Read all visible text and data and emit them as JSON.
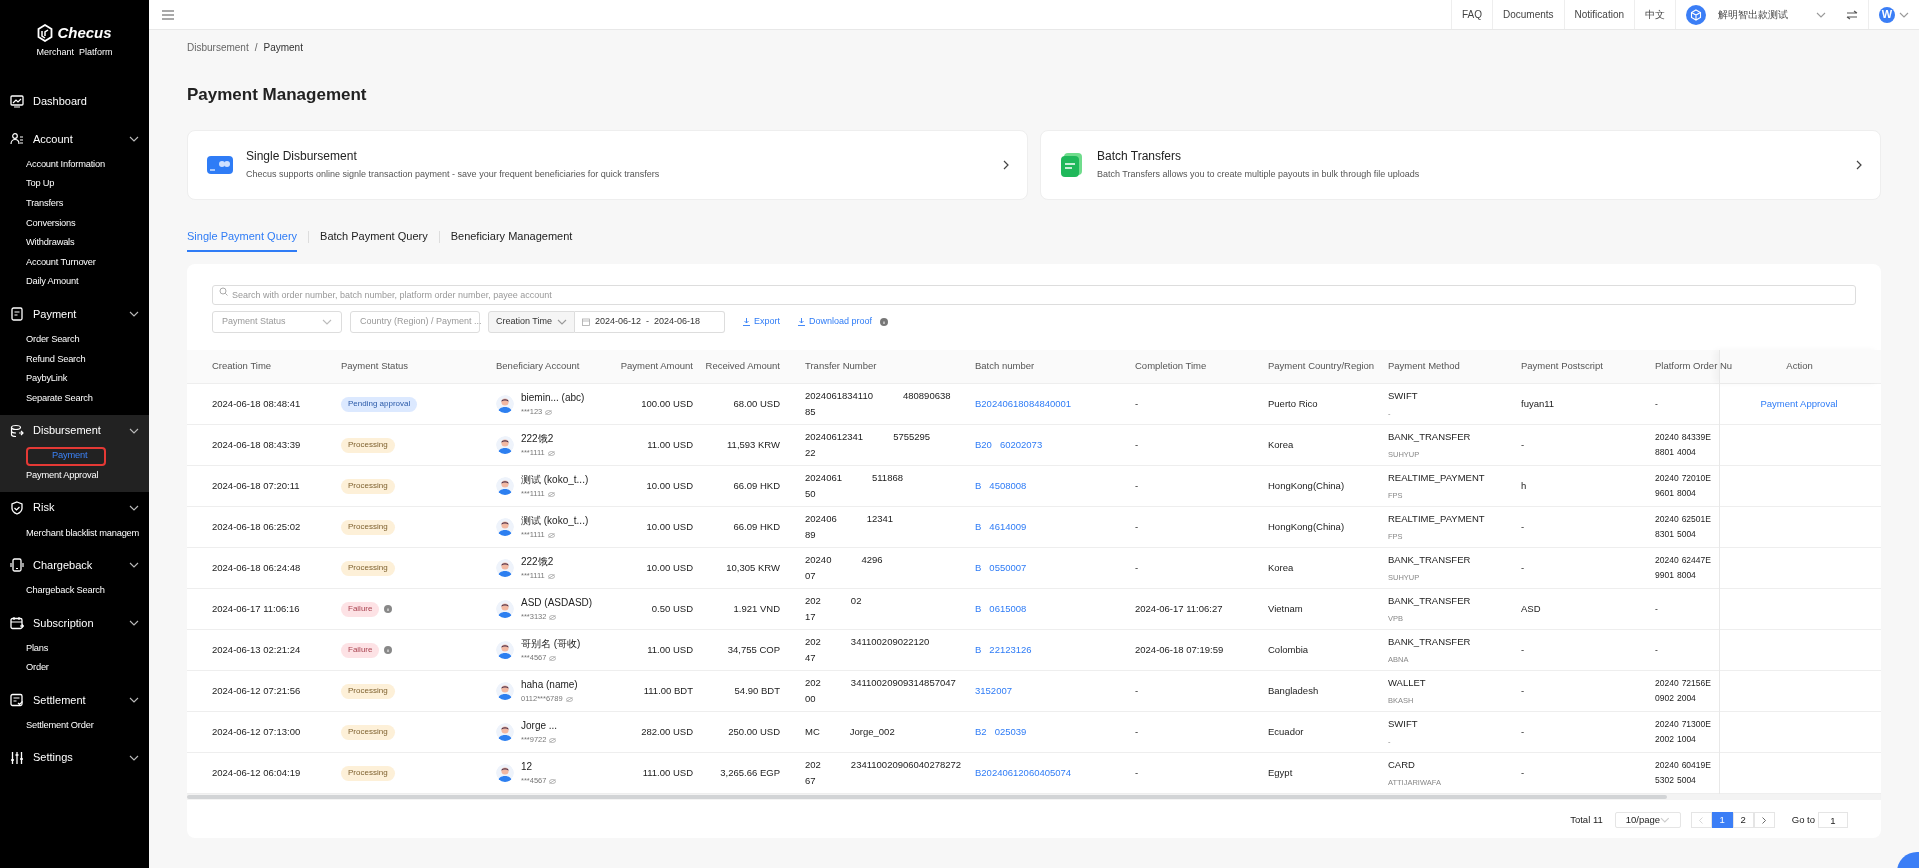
{
  "brand": {
    "name": "Checus",
    "subtitle": "Merchant  Platform"
  },
  "sidebar": [
    {
      "label": "Dashboard",
      "kind": "link",
      "active": false
    },
    {
      "label": "Account",
      "kind": "group",
      "active": false,
      "expanded": true,
      "children": [
        {
          "label": "Account Information",
          "selected": false
        },
        {
          "label": "Top Up",
          "selected": false
        },
        {
          "label": "Transfers",
          "selected": false
        },
        {
          "label": "Conversions",
          "selected": false
        },
        {
          "label": "Withdrawals",
          "selected": false
        },
        {
          "label": "Account Turnover",
          "selected": false
        },
        {
          "label": "Daily Amount",
          "selected": false
        }
      ]
    },
    {
      "label": "Payment",
      "kind": "group",
      "active": false,
      "expanded": true,
      "children": [
        {
          "label": "Order Search",
          "selected": false
        },
        {
          "label": "Refund Search",
          "selected": false
        },
        {
          "label": "PaybyLink",
          "selected": false
        },
        {
          "label": "Separate Search",
          "selected": false
        }
      ]
    },
    {
      "label": "Disbursement",
      "kind": "group",
      "active": true,
      "expanded": true,
      "children": [
        {
          "label": "Payment",
          "selected": true
        },
        {
          "label": "Payment Approval",
          "selected": false
        }
      ]
    },
    {
      "label": "Risk",
      "kind": "group",
      "active": false,
      "expanded": true,
      "children": [
        {
          "label": "Merchant blacklist managem",
          "selected": false
        }
      ]
    },
    {
      "label": "Chargeback",
      "kind": "group",
      "active": false,
      "expanded": true,
      "children": [
        {
          "label": "Chargeback Search",
          "selected": false
        }
      ]
    },
    {
      "label": "Subscription",
      "kind": "group",
      "active": false,
      "expanded": true,
      "children": [
        {
          "label": "Plans",
          "selected": false
        },
        {
          "label": "Order",
          "selected": false
        }
      ]
    },
    {
      "label": "Settlement",
      "kind": "group",
      "active": false,
      "expanded": true,
      "children": [
        {
          "label": "Settlement Order",
          "selected": false
        }
      ]
    },
    {
      "label": "Settings",
      "kind": "group",
      "active": false,
      "expanded": true
    }
  ],
  "header": {
    "links": [
      "FAQ",
      "Documents",
      "Notification",
      "中文"
    ],
    "merchant": "解明智出款测试",
    "user_initial": "W"
  },
  "breadcrumb": [
    "Disbursement",
    "/",
    "Payment"
  ],
  "title": "Payment Management",
  "cards": [
    {
      "kind": "single",
      "title": "Single Disbursement",
      "description": "Checus supports online signle transaction payment - save your frequent beneficiaries for quick transfers"
    },
    {
      "kind": "batch",
      "title": "Batch Transfers",
      "description": "Batch Transfers allows you to create multiple payouts in bulk through file uploads"
    }
  ],
  "tabs": [
    {
      "label": "Single Payment Query",
      "selected": true
    },
    {
      "label": "Batch Payment Query",
      "selected": false
    },
    {
      "label": "Beneficiary Management",
      "selected": false
    }
  ],
  "search": {
    "placeholder": "Search with order number, batch number, platform order number, payee account"
  },
  "filters": {
    "status_placeholder": "Payment Status",
    "country_placeholder": "Country (Region) / Payment ...",
    "time_field": "Creation Time",
    "date_from": "2024-06-12",
    "date_sep": "-",
    "date_to": "2024-06-18",
    "export": "Export",
    "download": "Download proof"
  },
  "table": {
    "columns": [
      "Creation Time",
      "Payment Status",
      "Beneficiary Account",
      "Payment Amount",
      "Received Amount",
      "Transfer Number",
      "Batch number",
      "Completion Time",
      "Payment Country/Region",
      "Payment Method",
      "Payment Postscript",
      "Platform Order Nu",
      "Action"
    ],
    "rows": [
      {
        "time": "2024-06-18 08:48:41",
        "status": {
          "label": "Pending approval",
          "kind": "pending"
        },
        "name": "biemin... (abc)",
        "account": "***123",
        "amount": "100.00 USD",
        "received": "68.00 USD",
        "transfer": [
          [
            "2024061834110",
            "480890638"
          ],
          [
            "85"
          ]
        ],
        "batch": [
          "B20240618084840001"
        ],
        "completion": "-",
        "country": "Puerto Rico",
        "method": "SWIFT",
        "channel": "-",
        "postscript": "fuyan11",
        "platform": [
          [
            "-"
          ]
        ],
        "action": "Payment Approval"
      },
      {
        "time": "2024-06-18 08:43:39",
        "status": {
          "label": "Processing",
          "kind": "processing"
        },
        "name": "222饿2",
        "account": "***1111",
        "amount": "11.00 USD",
        "received": "11,593 KRW",
        "transfer": [
          [
            "20240612341",
            "5755295"
          ],
          [
            "22"
          ]
        ],
        "batch": [
          "B20",
          "60202073"
        ],
        "completion": "-",
        "country": "Korea",
        "method": "BANK_TRANSFER",
        "channel": "SUHYUP",
        "postscript": "-",
        "platform": [
          [
            "20240",
            "84339E"
          ],
          [
            "8801",
            "4004"
          ]
        ]
      },
      {
        "time": "2024-06-18 07:20:11",
        "status": {
          "label": "Processing",
          "kind": "processing"
        },
        "name": "测试 (koko_t...)",
        "account": "***1111",
        "amount": "10.00 USD",
        "received": "66.09 HKD",
        "transfer": [
          [
            "2024061",
            "511868"
          ],
          [
            "50"
          ]
        ],
        "batch": [
          "B",
          "4508008"
        ],
        "completion": "-",
        "country": "HongKong(China)",
        "method": "REALTIME_PAYMENT",
        "channel": "FPS",
        "postscript": "h",
        "platform": [
          [
            "20240",
            "72010E"
          ],
          [
            "9601",
            "8004"
          ]
        ]
      },
      {
        "time": "2024-06-18 06:25:02",
        "status": {
          "label": "Processing",
          "kind": "processing"
        },
        "name": "测试 (koko_t...)",
        "account": "***1111",
        "amount": "10.00 USD",
        "received": "66.09 HKD",
        "transfer": [
          [
            "202406",
            "12341"
          ],
          [
            "89"
          ]
        ],
        "batch": [
          "B",
          "4614009"
        ],
        "completion": "-",
        "country": "HongKong(China)",
        "method": "REALTIME_PAYMENT",
        "channel": "FPS",
        "postscript": "-",
        "platform": [
          [
            "20240",
            "62501E"
          ],
          [
            "8301",
            "5004"
          ]
        ]
      },
      {
        "time": "2024-06-18 06:24:48",
        "status": {
          "label": "Processing",
          "kind": "processing"
        },
        "name": "222饿2",
        "account": "***1111",
        "amount": "10.00 USD",
        "received": "10,305 KRW",
        "transfer": [
          [
            "20240",
            "4296"
          ],
          [
            "07"
          ]
        ],
        "batch": [
          "B",
          "0550007"
        ],
        "completion": "-",
        "country": "Korea",
        "method": "BANK_TRANSFER",
        "channel": "SUHYUP",
        "postscript": "-",
        "platform": [
          [
            "20240",
            "62447E"
          ],
          [
            "9901",
            "8004"
          ]
        ]
      },
      {
        "time": "2024-06-17 11:06:16",
        "status": {
          "label": "Failure",
          "kind": "failure"
        },
        "name": "ASD (ASDASD)",
        "account": "***3132",
        "amount": "0.50 USD",
        "received": "1.921 VND",
        "transfer": [
          [
            "202",
            "02"
          ],
          [
            "17"
          ]
        ],
        "batch": [
          "B",
          "0615008"
        ],
        "completion": "2024-06-17 11:06:27",
        "country": "Vietnam",
        "method": "BANK_TRANSFER",
        "channel": "VPB",
        "postscript": "ASD",
        "platform": [
          [
            "-"
          ]
        ]
      },
      {
        "time": "2024-06-13 02:21:24",
        "status": {
          "label": "Failure",
          "kind": "failure"
        },
        "name": "哥别名 (哥收)",
        "account": "***4567",
        "amount": "11.00 USD",
        "received": "34,755 COP",
        "transfer": [
          [
            "202",
            "341100209022120"
          ],
          [
            "47"
          ]
        ],
        "batch": [
          "B",
          "22123126"
        ],
        "completion": "2024-06-18 07:19:59",
        "country": "Colombia",
        "method": "BANK_TRANSFER",
        "channel": "ABNA",
        "postscript": "-",
        "platform": [
          [
            "-"
          ]
        ]
      },
      {
        "time": "2024-06-12 07:21:56",
        "status": {
          "label": "Processing",
          "kind": "processing"
        },
        "name": "haha (name)",
        "account": "0112***6789",
        "amount": "111.00 BDT",
        "received": "54.90 BDT",
        "transfer": [
          [
            "202",
            "34110020909314857047"
          ],
          [
            "00"
          ]
        ],
        "batch": [
          "3152007"
        ],
        "completion": "-",
        "country": "Bangladesh",
        "method": "WALLET",
        "channel": "BKASH",
        "postscript": "-",
        "platform": [
          [
            "20240",
            "72156E"
          ],
          [
            "0902",
            "2004"
          ]
        ]
      },
      {
        "time": "2024-06-12 07:13:00",
        "status": {
          "label": "Processing",
          "kind": "processing"
        },
        "name": "Jorge ...",
        "account": "***9722",
        "amount": "282.00 USD",
        "received": "250.00 USD",
        "transfer": [
          [
            "MC",
            "Jorge_002"
          ]
        ],
        "batch": [
          "B2",
          "025039"
        ],
        "completion": "-",
        "country": "Ecuador",
        "method": "SWIFT",
        "channel": "-",
        "postscript": "-",
        "platform": [
          [
            "20240",
            "71300E"
          ],
          [
            "2002",
            "1004"
          ]
        ]
      },
      {
        "time": "2024-06-12 06:04:19",
        "status": {
          "label": "Processing",
          "kind": "processing"
        },
        "name": "12",
        "account": "***4567",
        "amount": "111.00 USD",
        "received": "3,265.66 EGP",
        "transfer": [
          [
            "202",
            "234110020906040278272"
          ],
          [
            "67"
          ]
        ],
        "batch": [
          "B20240612060405074"
        ],
        "completion": "-",
        "country": "Egypt",
        "method": "CARD",
        "channel": "ATTIJARIWAFA",
        "postscript": "-",
        "platform": [
          [
            "20240",
            "60419E"
          ],
          [
            "5302",
            "5004"
          ]
        ]
      }
    ]
  },
  "pagination": {
    "total": "Total 11",
    "page_size": "10/page",
    "pages": [
      {
        "label": "1",
        "selected": true
      },
      {
        "label": "2",
        "selected": false
      }
    ],
    "prev_disabled": true,
    "goto_label": "Go to",
    "goto_value": "1"
  }
}
